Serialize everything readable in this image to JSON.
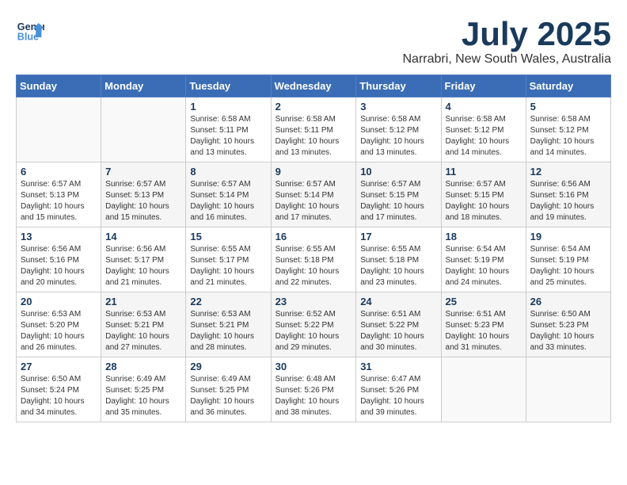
{
  "header": {
    "logo_line1": "General",
    "logo_line2": "Blue",
    "month": "July 2025",
    "location": "Narrabri, New South Wales, Australia"
  },
  "weekdays": [
    "Sunday",
    "Monday",
    "Tuesday",
    "Wednesday",
    "Thursday",
    "Friday",
    "Saturday"
  ],
  "weeks": [
    [
      {
        "day": "",
        "info": ""
      },
      {
        "day": "",
        "info": ""
      },
      {
        "day": "1",
        "info": "Sunrise: 6:58 AM\nSunset: 5:11 PM\nDaylight: 10 hours and 13 minutes."
      },
      {
        "day": "2",
        "info": "Sunrise: 6:58 AM\nSunset: 5:11 PM\nDaylight: 10 hours and 13 minutes."
      },
      {
        "day": "3",
        "info": "Sunrise: 6:58 AM\nSunset: 5:12 PM\nDaylight: 10 hours and 13 minutes."
      },
      {
        "day": "4",
        "info": "Sunrise: 6:58 AM\nSunset: 5:12 PM\nDaylight: 10 hours and 14 minutes."
      },
      {
        "day": "5",
        "info": "Sunrise: 6:58 AM\nSunset: 5:12 PM\nDaylight: 10 hours and 14 minutes."
      }
    ],
    [
      {
        "day": "6",
        "info": "Sunrise: 6:57 AM\nSunset: 5:13 PM\nDaylight: 10 hours and 15 minutes."
      },
      {
        "day": "7",
        "info": "Sunrise: 6:57 AM\nSunset: 5:13 PM\nDaylight: 10 hours and 15 minutes."
      },
      {
        "day": "8",
        "info": "Sunrise: 6:57 AM\nSunset: 5:14 PM\nDaylight: 10 hours and 16 minutes."
      },
      {
        "day": "9",
        "info": "Sunrise: 6:57 AM\nSunset: 5:14 PM\nDaylight: 10 hours and 17 minutes."
      },
      {
        "day": "10",
        "info": "Sunrise: 6:57 AM\nSunset: 5:15 PM\nDaylight: 10 hours and 17 minutes."
      },
      {
        "day": "11",
        "info": "Sunrise: 6:57 AM\nSunset: 5:15 PM\nDaylight: 10 hours and 18 minutes."
      },
      {
        "day": "12",
        "info": "Sunrise: 6:56 AM\nSunset: 5:16 PM\nDaylight: 10 hours and 19 minutes."
      }
    ],
    [
      {
        "day": "13",
        "info": "Sunrise: 6:56 AM\nSunset: 5:16 PM\nDaylight: 10 hours and 20 minutes."
      },
      {
        "day": "14",
        "info": "Sunrise: 6:56 AM\nSunset: 5:17 PM\nDaylight: 10 hours and 21 minutes."
      },
      {
        "day": "15",
        "info": "Sunrise: 6:55 AM\nSunset: 5:17 PM\nDaylight: 10 hours and 21 minutes."
      },
      {
        "day": "16",
        "info": "Sunrise: 6:55 AM\nSunset: 5:18 PM\nDaylight: 10 hours and 22 minutes."
      },
      {
        "day": "17",
        "info": "Sunrise: 6:55 AM\nSunset: 5:18 PM\nDaylight: 10 hours and 23 minutes."
      },
      {
        "day": "18",
        "info": "Sunrise: 6:54 AM\nSunset: 5:19 PM\nDaylight: 10 hours and 24 minutes."
      },
      {
        "day": "19",
        "info": "Sunrise: 6:54 AM\nSunset: 5:19 PM\nDaylight: 10 hours and 25 minutes."
      }
    ],
    [
      {
        "day": "20",
        "info": "Sunrise: 6:53 AM\nSunset: 5:20 PM\nDaylight: 10 hours and 26 minutes."
      },
      {
        "day": "21",
        "info": "Sunrise: 6:53 AM\nSunset: 5:21 PM\nDaylight: 10 hours and 27 minutes."
      },
      {
        "day": "22",
        "info": "Sunrise: 6:53 AM\nSunset: 5:21 PM\nDaylight: 10 hours and 28 minutes."
      },
      {
        "day": "23",
        "info": "Sunrise: 6:52 AM\nSunset: 5:22 PM\nDaylight: 10 hours and 29 minutes."
      },
      {
        "day": "24",
        "info": "Sunrise: 6:51 AM\nSunset: 5:22 PM\nDaylight: 10 hours and 30 minutes."
      },
      {
        "day": "25",
        "info": "Sunrise: 6:51 AM\nSunset: 5:23 PM\nDaylight: 10 hours and 31 minutes."
      },
      {
        "day": "26",
        "info": "Sunrise: 6:50 AM\nSunset: 5:23 PM\nDaylight: 10 hours and 33 minutes."
      }
    ],
    [
      {
        "day": "27",
        "info": "Sunrise: 6:50 AM\nSunset: 5:24 PM\nDaylight: 10 hours and 34 minutes."
      },
      {
        "day": "28",
        "info": "Sunrise: 6:49 AM\nSunset: 5:25 PM\nDaylight: 10 hours and 35 minutes."
      },
      {
        "day": "29",
        "info": "Sunrise: 6:49 AM\nSunset: 5:25 PM\nDaylight: 10 hours and 36 minutes."
      },
      {
        "day": "30",
        "info": "Sunrise: 6:48 AM\nSunset: 5:26 PM\nDaylight: 10 hours and 38 minutes."
      },
      {
        "day": "31",
        "info": "Sunrise: 6:47 AM\nSunset: 5:26 PM\nDaylight: 10 hours and 39 minutes."
      },
      {
        "day": "",
        "info": ""
      },
      {
        "day": "",
        "info": ""
      }
    ]
  ]
}
